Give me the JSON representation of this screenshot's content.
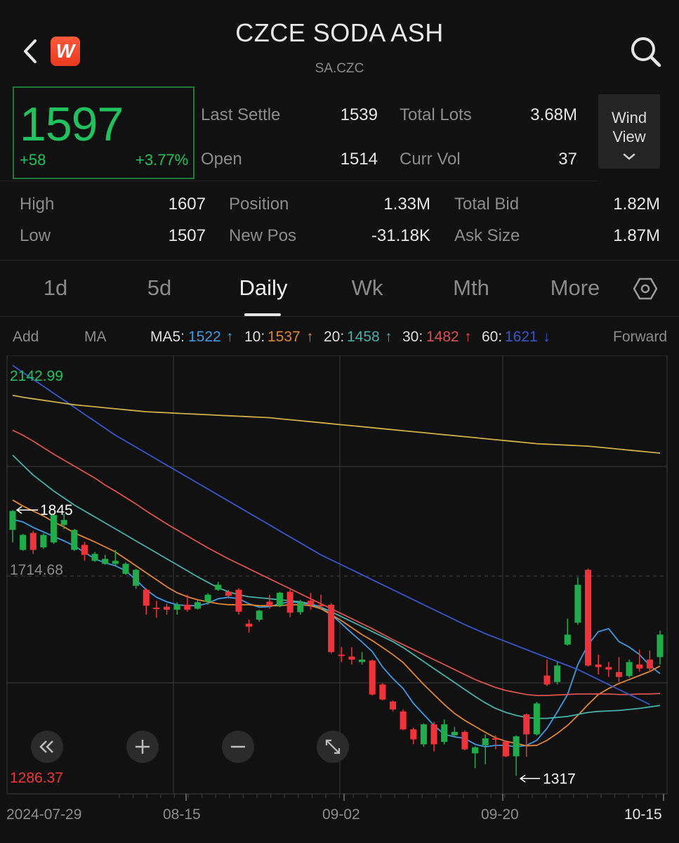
{
  "header": {
    "title": "CZCE SODA ASH",
    "code": "SA.CZC",
    "logo_text": "W"
  },
  "quote": {
    "price": "1597",
    "change": "+58",
    "change_pct": "+3.77%",
    "last_settle_label": "Last Settle",
    "last_settle": "1539",
    "total_lots_label": "Total Lots",
    "total_lots": "3.68M",
    "open_label": "Open",
    "open": "1514",
    "curr_vol_label": "Curr Vol",
    "curr_vol": "37",
    "high_label": "High",
    "high": "1607",
    "low_label": "Low",
    "low": "1507",
    "position_label": "Position",
    "position": "1.33M",
    "new_pos_label": "New Pos",
    "new_pos": "-31.18K",
    "total_bid_label": "Total Bid",
    "total_bid": "1.82M",
    "ask_size_label": "Ask Size",
    "ask_size": "1.87M",
    "wind_view_line1": "Wind",
    "wind_view_line2": "View"
  },
  "tabs": [
    "1d",
    "5d",
    "Daily",
    "Wk",
    "Mth",
    "More"
  ],
  "active_tab": "Daily",
  "indicators": {
    "add": "Add",
    "ma": "MA",
    "ma5_label": "MA5:",
    "ma5": "1522",
    "ma10_label": "10:",
    "ma10": "1537",
    "ma20_label": "20:",
    "ma20": "1458",
    "ma30_label": "30:",
    "ma30": "1482",
    "ma60_label": "60:",
    "ma60": "1621",
    "forward": "Forward",
    "up_arrow": "↑",
    "down_arrow": "↓"
  },
  "colors": {
    "up": "#f0333a",
    "down": "#1fad4c",
    "ma5": "#3c9be3",
    "ma10": "#e0862f",
    "ma20": "#45b0a8",
    "ma30": "#d9524e",
    "ma60": "#3a55c8",
    "ma120": "#cdb04a",
    "price_green": "#1fc25e"
  },
  "chart_data": {
    "type": "candlestick",
    "y_max_label": "2142.99",
    "y_mid_label": "1714.68",
    "y_min_label": "1286.37",
    "ylim": [
      1286.37,
      2142.99
    ],
    "max_annotation": "1845",
    "min_annotation": "1317",
    "x_labels": [
      "2024-07-29",
      "08-15",
      "09-02",
      "09-20",
      "10-15"
    ],
    "candles": [
      {
        "o": 1810,
        "c": 1848,
        "h": 1850,
        "l": 1785
      },
      {
        "o": 1770,
        "c": 1800,
        "h": 1802,
        "l": 1768
      },
      {
        "o": 1804,
        "c": 1770,
        "h": 1808,
        "l": 1762
      },
      {
        "o": 1775,
        "c": 1800,
        "h": 1803,
        "l": 1772
      },
      {
        "o": 1785,
        "c": 1840,
        "h": 1843,
        "l": 1782
      },
      {
        "o": 1820,
        "c": 1830,
        "h": 1842,
        "l": 1812
      },
      {
        "o": 1770,
        "c": 1810,
        "h": 1812,
        "l": 1768
      },
      {
        "o": 1780,
        "c": 1760,
        "h": 1786,
        "l": 1748
      },
      {
        "o": 1748,
        "c": 1762,
        "h": 1766,
        "l": 1746
      },
      {
        "o": 1742,
        "c": 1752,
        "h": 1760,
        "l": 1740
      },
      {
        "o": 1742,
        "c": 1748,
        "h": 1770,
        "l": 1738
      },
      {
        "o": 1722,
        "c": 1742,
        "h": 1745,
        "l": 1720
      },
      {
        "o": 1698,
        "c": 1730,
        "h": 1732,
        "l": 1692
      },
      {
        "o": 1690,
        "c": 1658,
        "h": 1693,
        "l": 1640
      },
      {
        "o": 1654,
        "c": 1652,
        "h": 1668,
        "l": 1634
      },
      {
        "o": 1656,
        "c": 1650,
        "h": 1662,
        "l": 1640
      },
      {
        "o": 1650,
        "c": 1660,
        "h": 1665,
        "l": 1640
      },
      {
        "o": 1660,
        "c": 1650,
        "h": 1680,
        "l": 1646
      },
      {
        "o": 1652,
        "c": 1665,
        "h": 1670,
        "l": 1650
      },
      {
        "o": 1666,
        "c": 1680,
        "h": 1683,
        "l": 1660
      },
      {
        "o": 1690,
        "c": 1700,
        "h": 1706,
        "l": 1688
      },
      {
        "o": 1686,
        "c": 1678,
        "h": 1690,
        "l": 1672
      },
      {
        "o": 1690,
        "c": 1646,
        "h": 1693,
        "l": 1640
      },
      {
        "o": 1622,
        "c": 1616,
        "h": 1630,
        "l": 1604
      },
      {
        "o": 1630,
        "c": 1648,
        "h": 1650,
        "l": 1626
      },
      {
        "o": 1666,
        "c": 1658,
        "h": 1680,
        "l": 1652
      },
      {
        "o": 1658,
        "c": 1684,
        "h": 1686,
        "l": 1655
      },
      {
        "o": 1686,
        "c": 1644,
        "h": 1690,
        "l": 1635
      },
      {
        "o": 1645,
        "c": 1665,
        "h": 1670,
        "l": 1640
      },
      {
        "o": 1668,
        "c": 1660,
        "h": 1684,
        "l": 1650
      },
      {
        "o": 1660,
        "c": 1657,
        "h": 1680,
        "l": 1650
      },
      {
        "o": 1660,
        "c": 1565,
        "h": 1663,
        "l": 1562
      },
      {
        "o": 1560,
        "c": 1558,
        "h": 1575,
        "l": 1545
      },
      {
        "o": 1556,
        "c": 1550,
        "h": 1575,
        "l": 1540
      },
      {
        "o": 1545,
        "c": 1550,
        "h": 1565,
        "l": 1540
      },
      {
        "o": 1548,
        "c": 1480,
        "h": 1550,
        "l": 1478
      },
      {
        "o": 1500,
        "c": 1470,
        "h": 1503,
        "l": 1468
      },
      {
        "o": 1466,
        "c": 1450,
        "h": 1468,
        "l": 1446
      },
      {
        "o": 1446,
        "c": 1410,
        "h": 1450,
        "l": 1408
      },
      {
        "o": 1410,
        "c": 1390,
        "h": 1413,
        "l": 1380
      },
      {
        "o": 1380,
        "c": 1420,
        "h": 1422,
        "l": 1375
      },
      {
        "o": 1420,
        "c": 1380,
        "h": 1425,
        "l": 1366
      },
      {
        "o": 1385,
        "c": 1420,
        "h": 1430,
        "l": 1380
      },
      {
        "o": 1398,
        "c": 1405,
        "h": 1415,
        "l": 1396
      },
      {
        "o": 1405,
        "c": 1370,
        "h": 1408,
        "l": 1368
      },
      {
        "o": 1362,
        "c": 1374,
        "h": 1376,
        "l": 1332
      },
      {
        "o": 1378,
        "c": 1392,
        "h": 1400,
        "l": 1340
      },
      {
        "o": 1392,
        "c": 1390,
        "h": 1398,
        "l": 1370
      },
      {
        "o": 1385,
        "c": 1356,
        "h": 1388,
        "l": 1354
      },
      {
        "o": 1356,
        "c": 1396,
        "h": 1398,
        "l": 1317
      },
      {
        "o": 1440,
        "c": 1400,
        "h": 1442,
        "l": 1355
      },
      {
        "o": 1400,
        "c": 1462,
        "h": 1465,
        "l": 1398
      },
      {
        "o": 1518,
        "c": 1500,
        "h": 1550,
        "l": 1497
      },
      {
        "o": 1505,
        "c": 1538,
        "h": 1545,
        "l": 1500
      },
      {
        "o": 1580,
        "c": 1600,
        "h": 1632,
        "l": 1578
      },
      {
        "o": 1624,
        "c": 1700,
        "h": 1715,
        "l": 1620
      },
      {
        "o": 1730,
        "c": 1538,
        "h": 1733,
        "l": 1536
      },
      {
        "o": 1540,
        "c": 1535,
        "h": 1560,
        "l": 1520
      },
      {
        "o": 1535,
        "c": 1530,
        "h": 1545,
        "l": 1515
      },
      {
        "o": 1525,
        "c": 1515,
        "h": 1555,
        "l": 1505
      },
      {
        "o": 1517,
        "c": 1545,
        "h": 1550,
        "l": 1514
      },
      {
        "o": 1540,
        "c": 1532,
        "h": 1570,
        "l": 1526
      },
      {
        "o": 1550,
        "c": 1532,
        "h": 1568,
        "l": 1525
      },
      {
        "o": 1555,
        "c": 1600,
        "h": 1608,
        "l": 1540
      }
    ],
    "series": [
      {
        "name": "MA5",
        "values": [
          1831,
          1826,
          1815,
          1806,
          1797,
          1788,
          1778,
          1765,
          1752,
          1744,
          1738,
          1728,
          1710,
          1690,
          1675,
          1666,
          1660,
          1658,
          1658,
          1663,
          1672,
          1675,
          1672,
          1662,
          1655,
          1656,
          1662,
          1666,
          1664,
          1660,
          1655,
          1640,
          1622,
          1603,
          1585,
          1566,
          1535,
          1512,
          1492,
          1462,
          1440,
          1418,
          1400,
          1395,
          1392,
          1380,
          1375,
          1378,
          1378,
          1375,
          1378,
          1388,
          1412,
          1445,
          1480,
          1540,
          1580,
          1606,
          1612,
          1586,
          1575,
          1560,
          1538,
          1522
        ]
      },
      {
        "name": "10",
        "values": [
          1870,
          1858,
          1848,
          1838,
          1826,
          1816,
          1804,
          1795,
          1786,
          1776,
          1766,
          1752,
          1738,
          1724,
          1710,
          1696,
          1684,
          1676,
          1670,
          1666,
          1662,
          1660,
          1660,
          1660,
          1658,
          1658,
          1658,
          1660,
          1660,
          1658,
          1652,
          1640,
          1628,
          1614,
          1600,
          1588,
          1574,
          1560,
          1544,
          1522,
          1500,
          1480,
          1460,
          1442,
          1428,
          1416,
          1404,
          1393,
          1386,
          1382,
          1377,
          1378,
          1388,
          1402,
          1418,
          1438,
          1460,
          1480,
          1492,
          1502,
          1510,
          1518,
          1526,
          1537
        ]
      },
      {
        "name": "20",
        "values": [
          1960,
          1940,
          1920,
          1904,
          1888,
          1874,
          1860,
          1848,
          1836,
          1824,
          1812,
          1800,
          1788,
          1776,
          1764,
          1752,
          1740,
          1728,
          1716,
          1705,
          1694,
          1686,
          1680,
          1676,
          1674,
          1672,
          1670,
          1668,
          1666,
          1662,
          1655,
          1646,
          1636,
          1626,
          1616,
          1606,
          1596,
          1586,
          1574,
          1560,
          1546,
          1532,
          1518,
          1504,
          1490,
          1476,
          1463,
          1452,
          1444,
          1438,
          1434,
          1432,
          1432,
          1434,
          1436,
          1440,
          1444,
          1446,
          1447,
          1448,
          1450,
          1452,
          1455,
          1458
        ]
      },
      {
        "name": "30",
        "values": [
          2010,
          2000,
          1988,
          1975,
          1962,
          1950,
          1938,
          1926,
          1914,
          1900,
          1888,
          1875,
          1862,
          1848,
          1835,
          1822,
          1810,
          1798,
          1786,
          1774,
          1763,
          1752,
          1742,
          1732,
          1722,
          1712,
          1702,
          1692,
          1682,
          1672,
          1662,
          1652,
          1642,
          1632,
          1622,
          1612,
          1601,
          1590,
          1580,
          1570,
          1560,
          1550,
          1540,
          1530,
          1520,
          1510,
          1502,
          1494,
          1488,
          1484,
          1480,
          1478,
          1478,
          1479,
          1480,
          1481,
          1481,
          1481,
          1481,
          1480,
          1480,
          1481,
          1481,
          1482
        ]
      },
      {
        "name": "60",
        "values": [
          2140,
          2126,
          2112,
          2098,
          2084,
          2070,
          2056,
          2042,
          2028,
          2014,
          2000,
          1988,
          1976,
          1964,
          1952,
          1940,
          1928,
          1916,
          1904,
          1892,
          1880,
          1868,
          1856,
          1844,
          1832,
          1820,
          1808,
          1796,
          1784,
          1772,
          1760,
          1750,
          1740,
          1730,
          1720,
          1710,
          1700,
          1690,
          1680,
          1670,
          1660,
          1650,
          1640,
          1630,
          1620,
          1611,
          1602,
          1594,
          1586,
          1578,
          1570,
          1562,
          1554,
          1546,
          1538,
          1530,
          1520,
          1510,
          1500,
          1490,
          1480,
          1470,
          1460,
          1621
        ]
      },
      {
        "name": "120",
        "values": [
          2080,
          2076,
          2073,
          2070,
          2067,
          2064,
          2061,
          2059,
          2057,
          2055,
          2053,
          2051,
          2049,
          2047,
          2046,
          2045,
          2044,
          2043,
          2042,
          2041,
          2040,
          2039,
          2038,
          2037,
          2036,
          2035,
          2033,
          2031,
          2029,
          2027,
          2025,
          2023,
          2021,
          2019,
          2017,
          2015,
          2013,
          2011,
          2009,
          2007,
          2005,
          2003,
          2001,
          1999,
          1997,
          1995,
          1993,
          1991,
          1989,
          1987,
          1985,
          1983,
          1982,
          1981,
          1980,
          1979,
          1978,
          1976,
          1974,
          1972,
          1970,
          1968,
          1966,
          1964
        ]
      }
    ]
  }
}
